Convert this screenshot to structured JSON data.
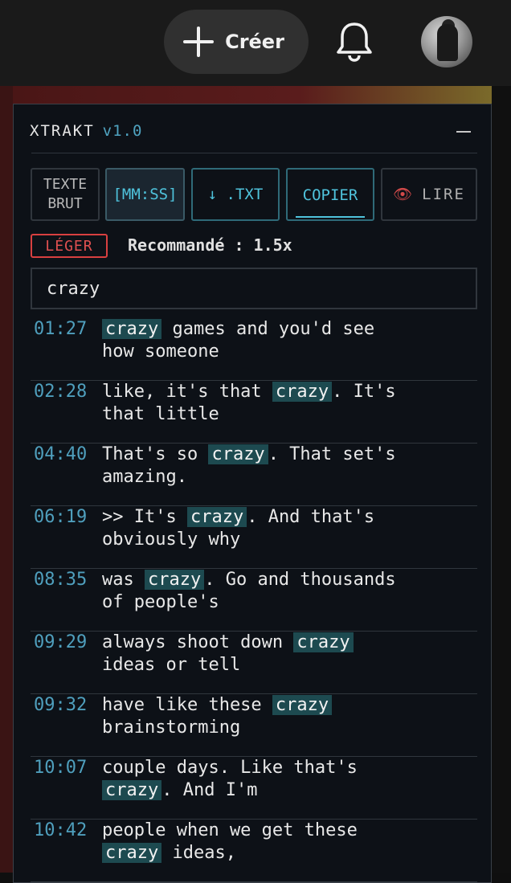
{
  "topbar": {
    "create_label": "Créer"
  },
  "panel": {
    "title": "XTRAKT",
    "version": "v1.0",
    "buttons": {
      "raw_line1": "TEXTE",
      "raw_line2": "BRUT",
      "timestamp": "[MM:SS]",
      "download": "↓ .TXT",
      "copy": "COPIER",
      "read": "LIRE"
    },
    "badge": "LÉGER",
    "recommend_label": "Recommandé :",
    "recommend_value": "1.5x",
    "search_value": "crazy",
    "results": [
      {
        "time": "01:27",
        "before": "",
        "match": "crazy",
        "after": " games and you'd see\nhow someone"
      },
      {
        "time": "02:28",
        "before": "like, it's that ",
        "match": "crazy",
        "after": ". It's\nthat little"
      },
      {
        "time": "04:40",
        "before": "That's so ",
        "match": "crazy",
        "after": ". That set's\namazing."
      },
      {
        "time": "06:19",
        "before": ">> It's ",
        "match": "crazy",
        "after": ". And that's\nobviously why"
      },
      {
        "time": "08:35",
        "before": "was ",
        "match": "crazy",
        "after": ". Go and thousands\nof people's"
      },
      {
        "time": "09:29",
        "before": "always shoot down ",
        "match": "crazy",
        "after": "\nideas or tell"
      },
      {
        "time": "09:32",
        "before": "have like these ",
        "match": "crazy",
        "after": "\nbrainstorming"
      },
      {
        "time": "10:07",
        "before": "couple days. Like that's\n",
        "match": "crazy",
        "after": ". And I'm"
      },
      {
        "time": "10:42",
        "before": "people when we get these\n",
        "match": "crazy",
        "after": " ideas,"
      }
    ]
  }
}
